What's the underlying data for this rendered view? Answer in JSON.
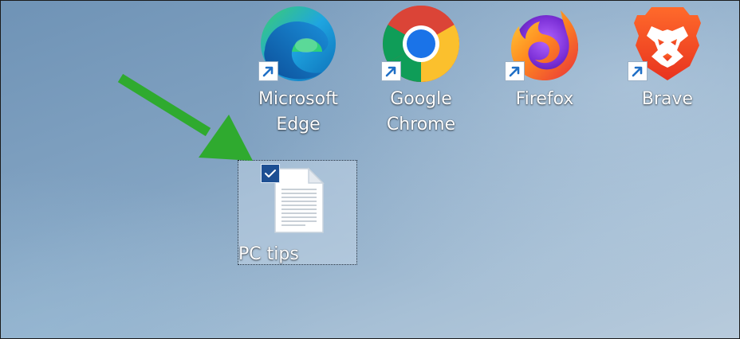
{
  "desktop": {
    "icons": [
      {
        "name": "Microsoft Edge",
        "label_line1": "Microsoft",
        "label_line2": "Edge",
        "icon": "edge-icon"
      },
      {
        "name": "Google Chrome",
        "label_line1": "Google",
        "label_line2": "Chrome",
        "icon": "chrome-icon"
      },
      {
        "name": "Firefox",
        "label_line1": "Firefox",
        "label_line2": "",
        "icon": "firefox-icon"
      },
      {
        "name": "Brave",
        "label_line1": "Brave",
        "label_line2": "",
        "icon": "brave-icon"
      }
    ],
    "selected_file": {
      "label": "PC tips",
      "icon": "text-document-icon",
      "selected": true
    },
    "annotation": {
      "icon": "green-arrow-icon",
      "color": "#2faa2f"
    }
  },
  "colors": {
    "selection_fill": "#cddcec",
    "checkbox": "#1d4f93",
    "shortcut_arrow": "#1f6fc6",
    "label_text": "#ffffff"
  }
}
